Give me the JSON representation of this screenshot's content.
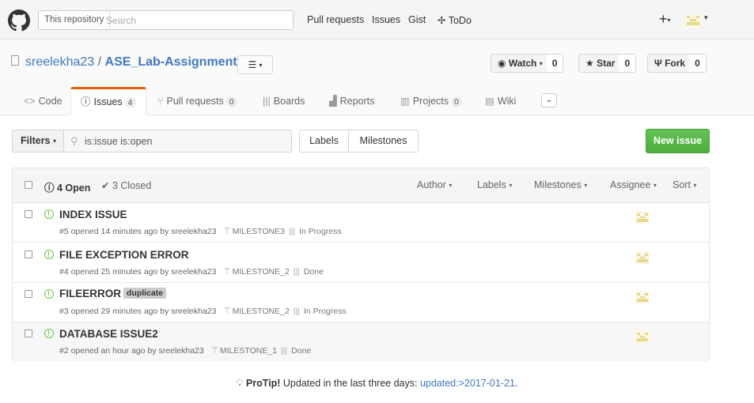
{
  "header": {
    "scope_label": "This repository",
    "search_placeholder": "Search",
    "nav": [
      "Pull requests",
      "Issues",
      "Gist",
      "ToDo"
    ]
  },
  "repo": {
    "owner": "sreelekha23",
    "separator": "/",
    "name": "ASE_Lab-Assignments",
    "watch_label": "Watch",
    "watch_count": "0",
    "star_label": "Star",
    "star_count": "0",
    "fork_label": "Fork",
    "fork_count": "0"
  },
  "tabs": [
    {
      "label": "Code",
      "counter": null
    },
    {
      "label": "Issues",
      "counter": "4"
    },
    {
      "label": "Pull requests",
      "counter": "0"
    },
    {
      "label": "Boards",
      "counter": null
    },
    {
      "label": "Reports",
      "counter": null
    },
    {
      "label": "Projects",
      "counter": "0"
    },
    {
      "label": "Wiki",
      "counter": null
    }
  ],
  "subnav": {
    "filters_label": "Filters",
    "filter_value": "is:issue is:open",
    "labels_label": "Labels",
    "milestones_label": "Milestones",
    "new_issue_label": "New issue"
  },
  "table_header": {
    "open": "4 Open",
    "closed": "3 Closed",
    "filters": [
      "Author",
      "Labels",
      "Milestones",
      "Assignee",
      "Sort"
    ]
  },
  "issues": [
    {
      "title": "INDEX ISSUE",
      "label": "",
      "meta": "#5 opened 14 minutes ago by sreelekha23",
      "milestone": "MILESTONE3",
      "project": "In Progress"
    },
    {
      "title": "FILE EXCEPTION ERROR",
      "label": "",
      "meta": "#4 opened 25 minutes ago by sreelekha23",
      "milestone": "MILESTONE_2",
      "project": "Done"
    },
    {
      "title": "FILEERROR",
      "label": "duplicate",
      "meta": "#3 opened 29 minutes ago by sreelekha23",
      "milestone": "MILESTONE_2",
      "project": "In Progress"
    },
    {
      "title": "DATABASE ISSUE2",
      "label": "",
      "meta": "#2 opened an hour ago by sreelekha23",
      "milestone": "MILESTONE_1",
      "project": "Done"
    }
  ],
  "protip": {
    "lead": "ProTip!",
    "text": "Updated in the last three days:",
    "query": "updated:>2017-01-21",
    "end": "."
  },
  "colors": {
    "accent_link": "#4078c0",
    "selected_tab": "#e36209",
    "new_issue_green": "#55b346",
    "open_icon": "#6cc644"
  }
}
